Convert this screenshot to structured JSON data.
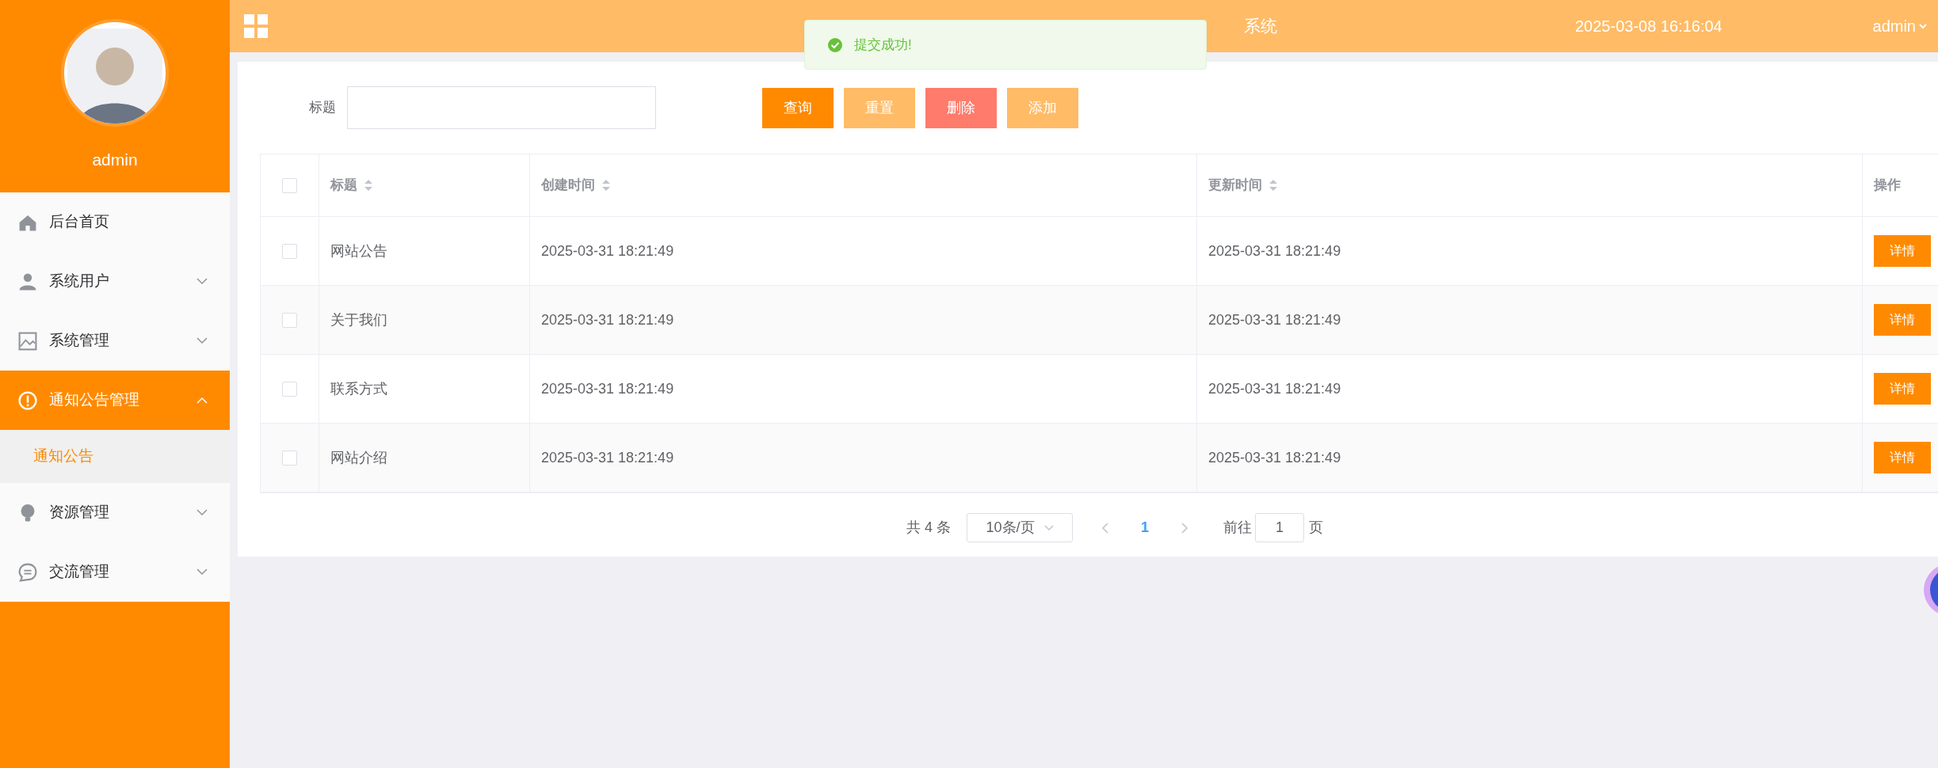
{
  "header": {
    "title_visible": "系统",
    "datetime": "2025-03-08 16:16:04",
    "user": "admin"
  },
  "toast": {
    "kind": "success",
    "message": "提交成功!"
  },
  "sidebar": {
    "username": "admin",
    "items": [
      {
        "label": "后台首页",
        "kind": "home",
        "selected": false
      },
      {
        "label": "系统用户",
        "kind": "user",
        "selected": false,
        "expanded": false
      },
      {
        "label": "系统管理",
        "kind": "image",
        "selected": false,
        "expanded": false
      },
      {
        "label": "通知公告管理",
        "kind": "alert",
        "selected": true,
        "expanded": true,
        "children": [
          {
            "label": "通知公告",
            "selected": true
          }
        ]
      },
      {
        "label": "资源管理",
        "kind": "bulb",
        "selected": false,
        "expanded": false
      },
      {
        "label": "交流管理",
        "kind": "chat",
        "selected": false,
        "expanded": false
      }
    ]
  },
  "search": {
    "label": "标题"
  },
  "buttons": [
    {
      "label": "查询",
      "kind": "primary"
    },
    {
      "label": "重置",
      "kind": "light"
    },
    {
      "label": "删除",
      "kind": "danger"
    },
    {
      "label": "添加",
      "kind": "light"
    }
  ],
  "table": {
    "select_all_checked": false,
    "columns": [
      {
        "label": "标题",
        "sortable": true
      },
      {
        "label": "创建时间",
        "sortable": true
      },
      {
        "label": "更新时间",
        "sortable": true
      },
      {
        "label": "操作",
        "sortable": false
      }
    ],
    "rows": [
      {
        "checked": false,
        "title": "网站公告",
        "created": "2025-03-31 18:21:49",
        "updated": "2025-03-31 18:21:49",
        "action": "详情"
      },
      {
        "checked": false,
        "title": "关于我们",
        "created": "2025-03-31 18:21:49",
        "updated": "2025-03-31 18:21:49",
        "action": "详情"
      },
      {
        "checked": false,
        "title": "联系方式",
        "created": "2025-03-31 18:21:49",
        "updated": "2025-03-31 18:21:49",
        "action": "详情"
      },
      {
        "checked": false,
        "title": "网站介绍",
        "created": "2025-03-31 18:21:49",
        "updated": "2025-03-31 18:21:49",
        "action": "详情"
      }
    ]
  },
  "pagination": {
    "total": "共 4 条",
    "page_size": "10条/页",
    "pages": [
      {
        "label": "1",
        "selected": true
      }
    ],
    "goto_label": "前往",
    "goto_value": "1",
    "goto_suffix": "页"
  }
}
